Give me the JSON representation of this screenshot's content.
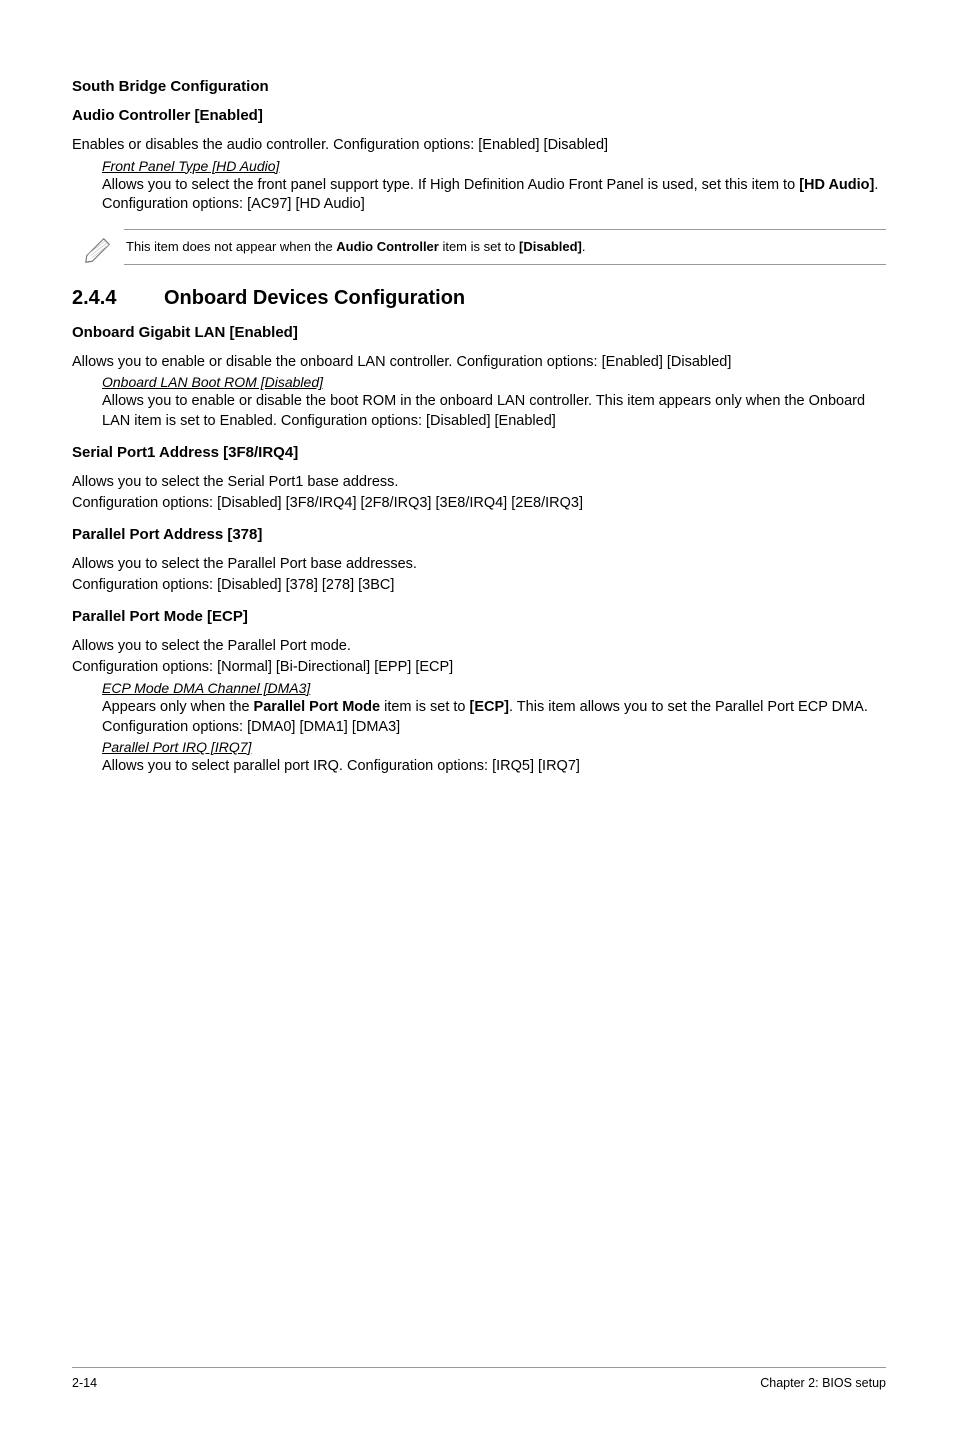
{
  "h_south_bridge": "South Bridge Configuration",
  "h_audio_ctrl": "Audio Controller [Enabled]",
  "p_audio_ctrl": "Enables or disables the audio controller. Configuration options: [Enabled] [Disabled]",
  "sub_front_panel_label": "Front Panel Type [HD Audio]",
  "sub_front_panel_p1": "Allows you to select the front panel support type. If High Definition Audio Front Panel is used, set this item to ",
  "sub_front_panel_bold": "[HD Audio]",
  "sub_front_panel_p2": ". Configuration options: [AC97] [HD Audio]",
  "note_p1": "This item does not appear when the ",
  "note_b1": "Audio Controller",
  "note_p2": " item is set to ",
  "note_b2": "[Disabled]",
  "note_p3": ".",
  "section_num": "2.4.4",
  "section_title": "Onboard Devices Configuration",
  "h_onboard_lan": "Onboard Gigabit LAN [Enabled]",
  "p_onboard_lan": "Allows you to enable or disable the onboard LAN controller. Configuration options: [Enabled] [Disabled]",
  "sub_onboard_lan_label": "Onboard LAN Boot ROM [Disabled]",
  "sub_onboard_lan_body": "Allows you to enable or disable the boot ROM in the onboard LAN controller. This item appears only when the Onboard LAN item is set to Enabled. Configuration options: [Disabled] [Enabled]",
  "h_serial": "Serial Port1 Address [3F8/IRQ4]",
  "p_serial_1": "Allows you to select the Serial Port1 base address.",
  "p_serial_2": "Configuration options: [Disabled] [3F8/IRQ4] [2F8/IRQ3] [3E8/IRQ4] [2E8/IRQ3]",
  "h_parallel_addr": "Parallel Port Address [378]",
  "p_parallel_addr_1": "Allows you to select the Parallel Port base addresses.",
  "p_parallel_addr_2": "Configuration options: [Disabled] [378] [278] [3BC]",
  "h_parallel_mode": "Parallel Port Mode [ECP]",
  "p_parallel_mode_1": "Allows you to select the Parallel Port mode.",
  "p_parallel_mode_2": "Configuration options: [Normal] [Bi-Directional] [EPP] [ECP]",
  "sub_ecp_label": "ECP Mode DMA Channel [DMA3]",
  "sub_ecp_p1": "Appears only when the ",
  "sub_ecp_b1": "Parallel Port Mode",
  "sub_ecp_p2": " item is set to ",
  "sub_ecp_b2": "[ECP]",
  "sub_ecp_p3": ". This item allows you to set the Parallel Port ECP DMA. Configuration options: [DMA0] [DMA1] [DMA3]",
  "sub_pp_irq_label": "Parallel Port IRQ [IRQ7]",
  "sub_pp_irq_body": "Allows you to select parallel port IRQ. Configuration options: [IRQ5] [IRQ7]",
  "footer_left": "2-14",
  "footer_right": "Chapter 2: BIOS setup"
}
